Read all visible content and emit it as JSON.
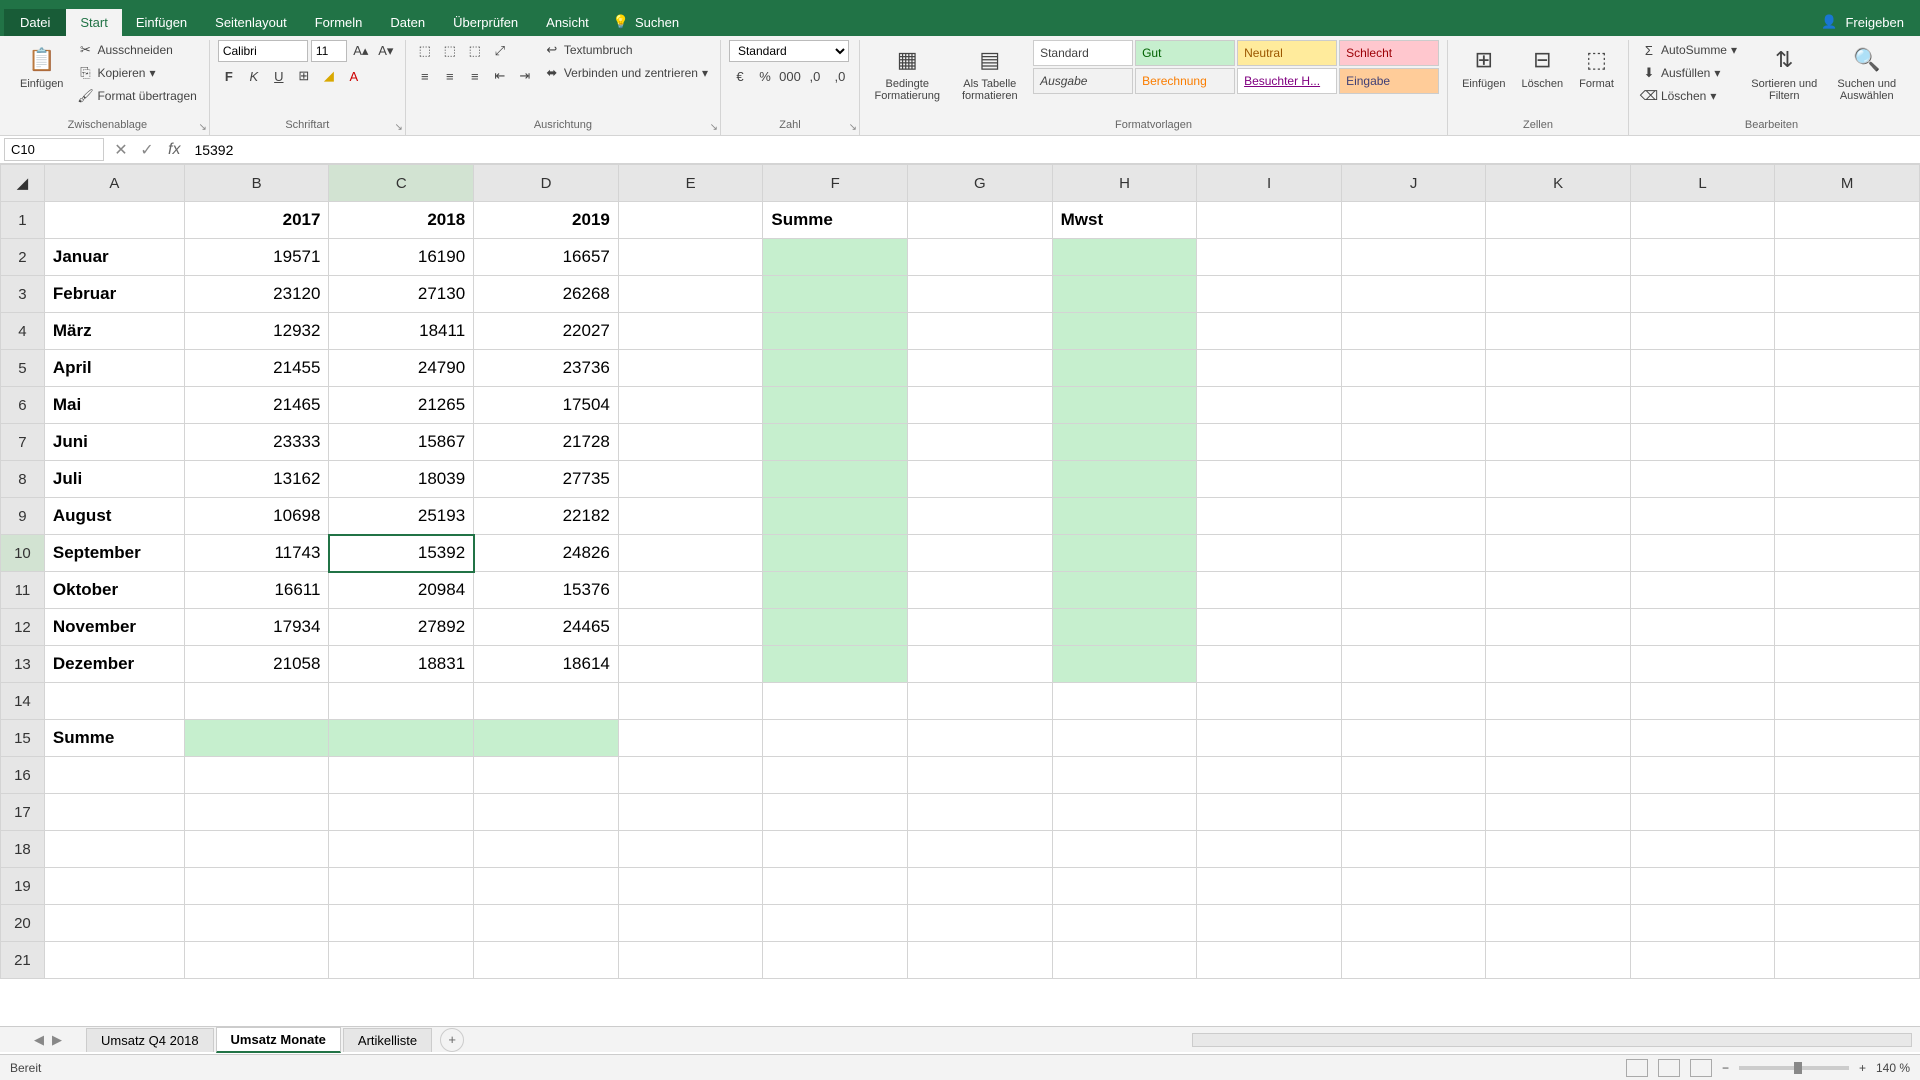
{
  "app": {
    "share": "Freigeben"
  },
  "tabs": {
    "datei": "Datei",
    "start": "Start",
    "einfuegen": "Einfügen",
    "seitenlayout": "Seitenlayout",
    "formeln": "Formeln",
    "daten": "Daten",
    "ueberpruefen": "Überprüfen",
    "ansicht": "Ansicht",
    "suchen": "Suchen"
  },
  "ribbon": {
    "zwischenablage": {
      "label": "Zwischenablage",
      "ausschneiden": "Ausschneiden",
      "kopieren": "Kopieren",
      "format": "Format übertragen",
      "einfuegen": "Einfügen"
    },
    "schriftart": {
      "label": "Schriftart",
      "font": "Calibri",
      "size": "11"
    },
    "ausrichtung": {
      "label": "Ausrichtung",
      "textumbruch": "Textumbruch",
      "verbinden": "Verbinden und zentrieren"
    },
    "zahl": {
      "label": "Zahl",
      "format": "Standard"
    },
    "formatvorlagen": {
      "label": "Formatvorlagen",
      "bedingte": "Bedingte Formatierung",
      "alstabelle": "Als Tabelle formatieren",
      "styles": {
        "standard": "Standard",
        "gut": "Gut",
        "neutral": "Neutral",
        "schlecht": "Schlecht",
        "ausgabe": "Ausgabe",
        "berechnung": "Berechnung",
        "besuchter": "Besuchter H...",
        "eingabe": "Eingabe"
      }
    },
    "zellen": {
      "label": "Zellen",
      "einfuegen": "Einfügen",
      "loeschen": "Löschen",
      "format": "Format"
    },
    "bearbeiten": {
      "label": "Bearbeiten",
      "autosumme": "AutoSumme",
      "ausfuellen": "Ausfüllen",
      "loeschen": "Löschen",
      "sortieren": "Sortieren und Filtern",
      "suchen": "Suchen und Auswählen"
    }
  },
  "namebox": "C10",
  "formula": "15392",
  "columns": [
    "A",
    "B",
    "C",
    "D",
    "E",
    "F",
    "G",
    "H",
    "I",
    "J",
    "K",
    "L",
    "M"
  ],
  "rows": [
    1,
    2,
    3,
    4,
    5,
    6,
    7,
    8,
    9,
    10,
    11,
    12,
    13,
    14,
    15,
    16,
    17,
    18,
    19,
    20,
    21
  ],
  "chart_data": {
    "type": "table",
    "title": "Umsatz Monate",
    "headers": {
      "B1": "2017",
      "C1": "2018",
      "D1": "2019",
      "F1": "Summe",
      "H1": "Mwst",
      "A15": "Summe"
    },
    "months": [
      "Januar",
      "Februar",
      "März",
      "April",
      "Mai",
      "Juni",
      "Juli",
      "August",
      "September",
      "Oktober",
      "November",
      "Dezember"
    ],
    "values": {
      "2017": [
        19571,
        23120,
        12932,
        21455,
        21465,
        23333,
        13162,
        10698,
        11743,
        16611,
        17934,
        21058
      ],
      "2018": [
        16190,
        27130,
        18411,
        24790,
        21265,
        15867,
        18039,
        25193,
        15392,
        20984,
        27892,
        18831
      ],
      "2019": [
        16657,
        26268,
        22027,
        23736,
        17504,
        21728,
        27735,
        22182,
        24826,
        15376,
        24465,
        18614
      ]
    }
  },
  "sheettabs": {
    "t1": "Umsatz Q4 2018",
    "t2": "Umsatz Monate",
    "t3": "Artikelliste"
  },
  "status": {
    "ready": "Bereit",
    "zoom": "140 %"
  }
}
